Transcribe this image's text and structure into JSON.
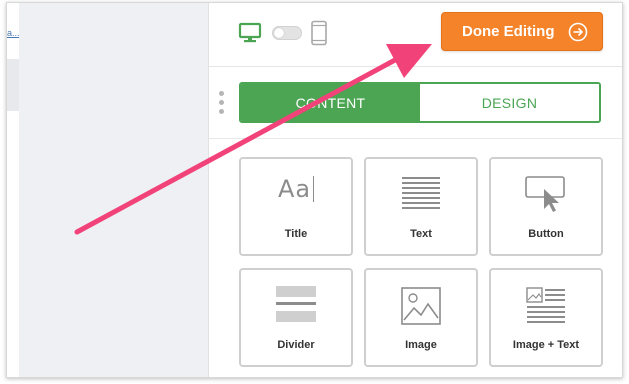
{
  "canvas": {
    "link_text": "a..."
  },
  "panel": {
    "view_toggle": {
      "desktop_icon": "desktop-icon",
      "mobile_icon": "mobile-icon"
    },
    "done_button": {
      "label": "Done Editing",
      "icon": "arrow-right-circle-icon"
    },
    "tabs": [
      {
        "label": "CONTENT",
        "active": true
      },
      {
        "label": "DESIGN",
        "active": false
      }
    ],
    "blocks": [
      {
        "label": "Title",
        "icon": "title-text-icon",
        "icon_text": "Aa"
      },
      {
        "label": "Text",
        "icon": "paragraph-lines-icon"
      },
      {
        "label": "Button",
        "icon": "button-cursor-icon"
      },
      {
        "label": "Divider",
        "icon": "divider-icon"
      },
      {
        "label": "Image",
        "icon": "image-icon"
      },
      {
        "label": "Image + Text",
        "icon": "image-text-icon"
      }
    ]
  },
  "colors": {
    "accent_green": "#4ba553",
    "done_orange": "#f4832a",
    "annotation_pink": "#f2427a"
  }
}
